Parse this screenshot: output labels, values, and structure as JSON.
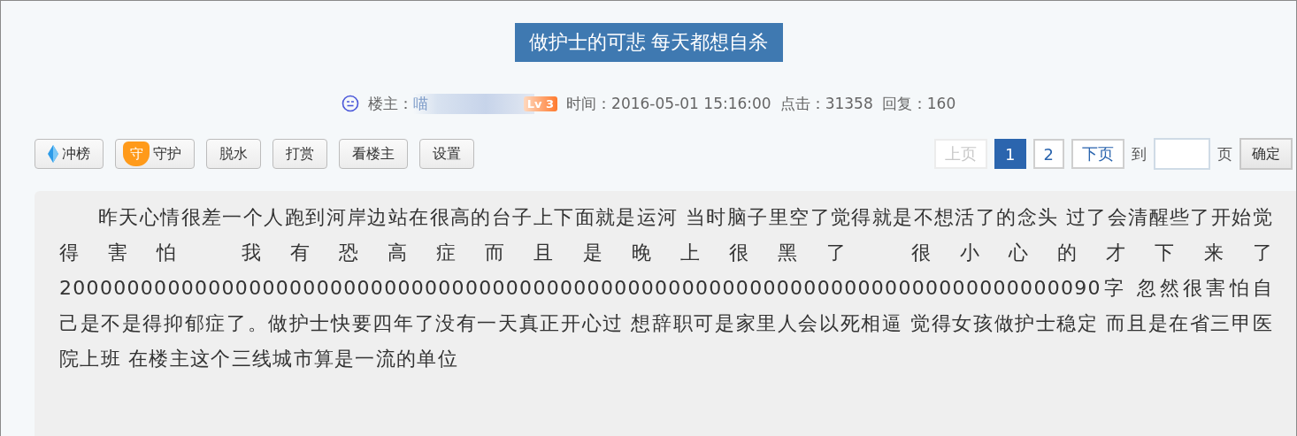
{
  "title": "做护士的可悲 每天都想自杀",
  "meta": {
    "author_label": "楼主：",
    "author": "喵",
    "level": "Lv 3",
    "time": "时间：2016-05-01 15:16:00",
    "clicks": "点击：31358",
    "replies": "回复：160"
  },
  "actions": [
    {
      "label": "冲榜",
      "kind": "gem"
    },
    {
      "label": "守护",
      "kind": "shield",
      "badge": "守"
    },
    {
      "label": "脱水",
      "kind": "plain"
    },
    {
      "label": "打赏",
      "kind": "plain"
    },
    {
      "label": "看楼主",
      "kind": "plain"
    },
    {
      "label": "设置",
      "kind": "plain"
    }
  ],
  "pager": {
    "prev": {
      "label": "上页",
      "disabled": true
    },
    "pages": [
      {
        "label": "1",
        "selected": true
      },
      {
        "label": "2",
        "selected": false
      }
    ],
    "next": {
      "label": "下页",
      "disabled": false
    },
    "goto_label": "到",
    "goto_suffix": "页",
    "confirm": "确定"
  },
  "post": {
    "text": "昨天心情很差一个人跑到河岸边站在很高的台子上下面就是运河 当时脑子里空了觉得就是不想活了的念头 过了会清醒些了开始觉得害怕 我有恐高症而且是晚上很黑了 很小心的才下来了 20000000000000000000000000000000000000000000000000000000000000000000000000090字 忽然很害怕自己是不是得抑郁症了。做护士快要四年了没有一天真正开心过 想辞职可是家里人会以死相逼 觉得女孩做护士稳定 而且是在省三甲医院上班 在楼主这个三线城市算是一流的单位"
  }
}
